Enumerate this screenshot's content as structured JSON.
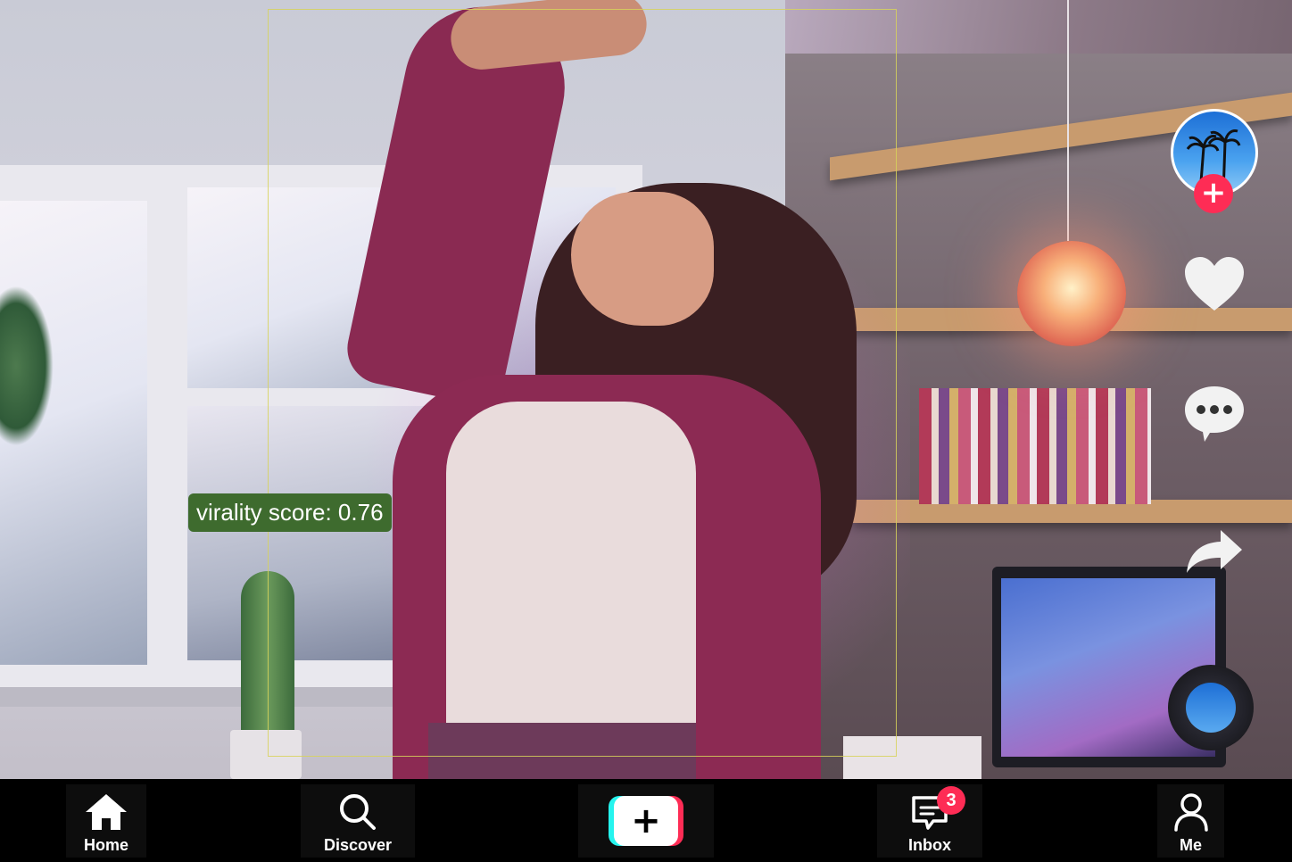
{
  "overlay": {
    "virality_label": "virality score: 0.76"
  },
  "actions": {
    "avatar_icon": "profile-avatar",
    "follow_symbol": "+",
    "like_icon": "heart-icon",
    "comment_icon": "comment-bubble-icon",
    "share_icon": "share-arrow-icon",
    "sound_icon": "music-disc-icon"
  },
  "bottom_nav": {
    "items": [
      {
        "label": "Home",
        "icon": "home-icon"
      },
      {
        "label": "Discover",
        "icon": "search-icon"
      },
      {
        "label": "",
        "icon": "create-plus-icon",
        "symbol": "+"
      },
      {
        "label": "Inbox",
        "icon": "inbox-icon",
        "badge": "3"
      },
      {
        "label": "Me",
        "icon": "profile-icon"
      }
    ]
  },
  "colors": {
    "accent_red": "#fe2c55",
    "accent_cyan": "#25f4ee",
    "label_bg": "#3e6b2e",
    "nav_bg": "#000000"
  }
}
